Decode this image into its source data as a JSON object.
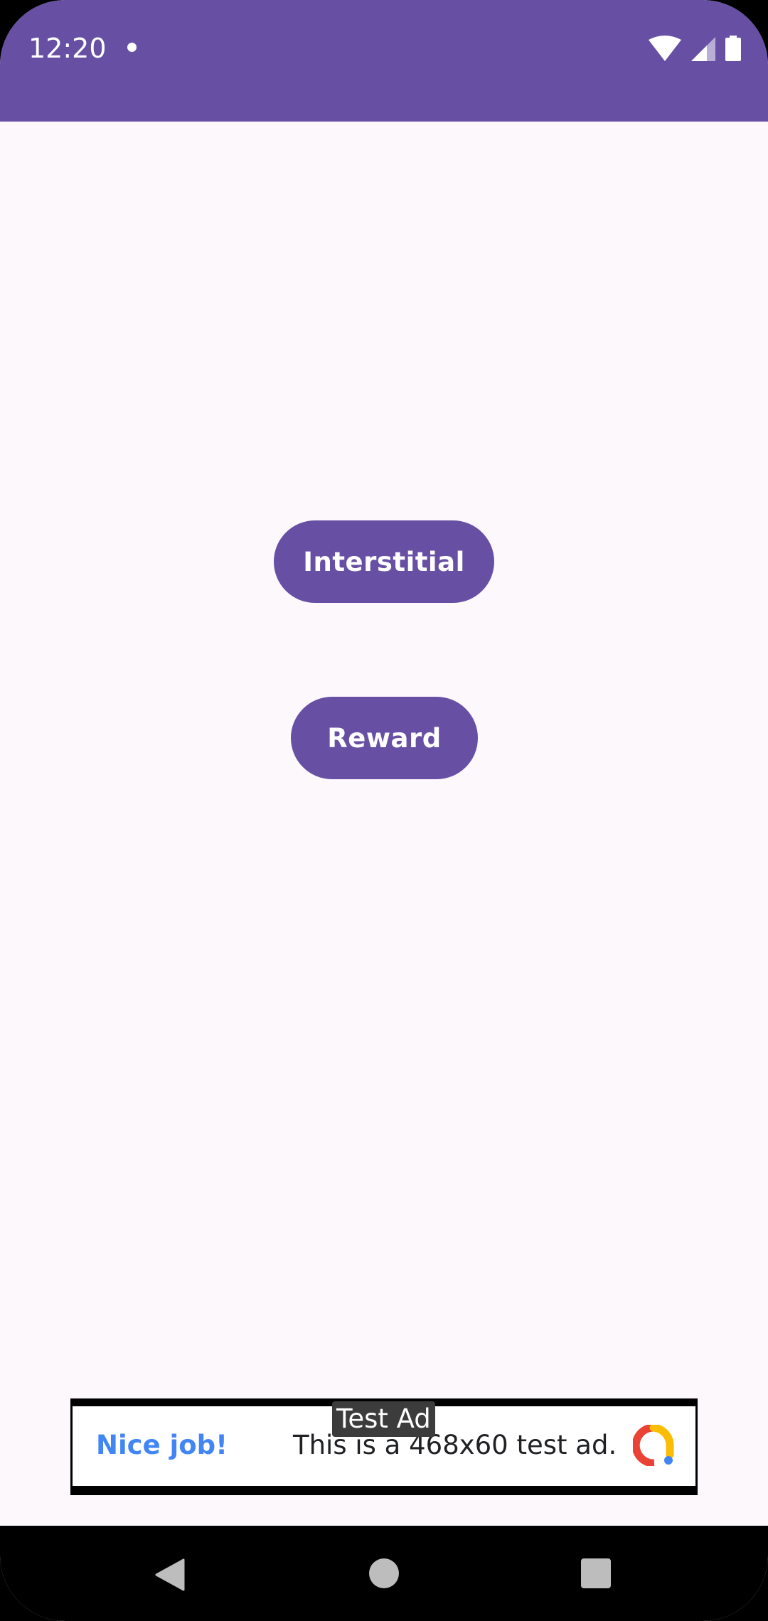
{
  "status_bar": {
    "time": "12:20",
    "background_color": "#6750a4",
    "icons": [
      "notification-dot-icon",
      "wifi-icon",
      "cell-signal-icon",
      "battery-icon"
    ]
  },
  "main": {
    "interstitial_label": "Interstitial",
    "reward_label": "Reward",
    "button_color": "#6750a4"
  },
  "ad": {
    "test_ad_label": "Test Ad",
    "headline": "Nice job!",
    "body": "This is a 468x60 test ad.",
    "logo_icon": "ad-manager-logo-icon"
  },
  "nav_bar": {
    "icons": [
      "back-icon",
      "home-icon",
      "recents-icon"
    ]
  }
}
